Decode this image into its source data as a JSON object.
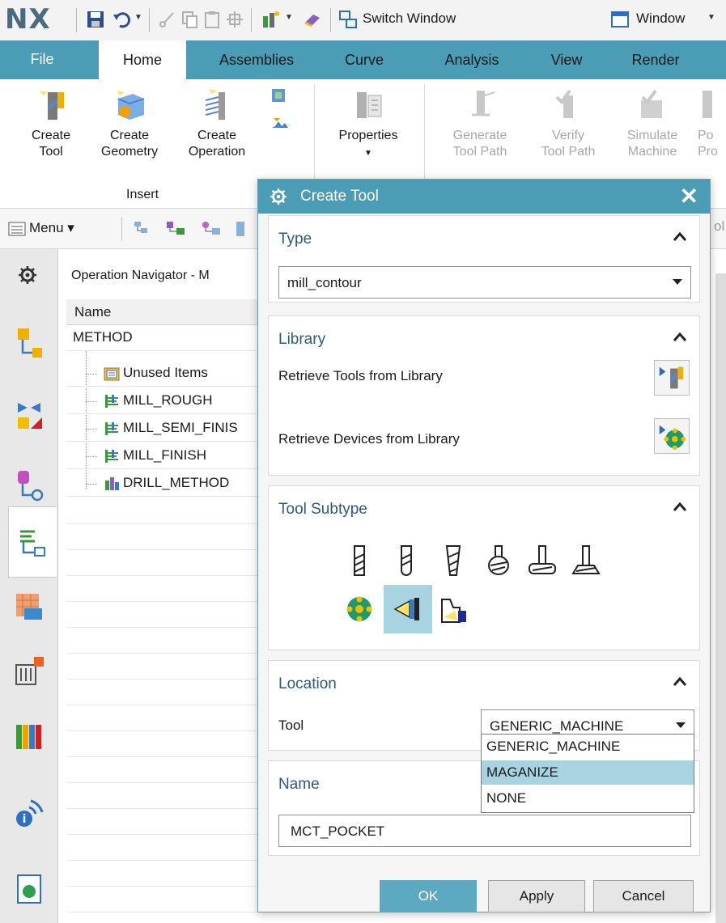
{
  "app": {
    "logo": "NX"
  },
  "quick_access": {
    "switch_window": "Switch Window",
    "window": "Window"
  },
  "ribbon": {
    "tabs": [
      "File",
      "Home",
      "Assemblies",
      "Curve",
      "Analysis",
      "View",
      "Render"
    ],
    "active_tab": "Home",
    "buttons": {
      "create_tool": [
        "Create",
        "Tool"
      ],
      "create_geometry": [
        "Create",
        "Geometry"
      ],
      "create_operation": [
        "Create",
        "Operation"
      ],
      "properties": "Properties",
      "generate_tool_path": [
        "Generate",
        "Tool Path"
      ],
      "verify_tool_path": [
        "Verify",
        "Tool Path"
      ],
      "simulate_machine": [
        "Simulate",
        "Machine"
      ],
      "post_process": [
        "Po",
        "Pro"
      ]
    },
    "group_insert": "Insert"
  },
  "toolbar2": {
    "menu": "Menu"
  },
  "navigator": {
    "title": "Operation Navigator - M",
    "column_name": "Name",
    "root": "METHOD",
    "items": [
      "Unused Items",
      "MILL_ROUGH",
      "MILL_SEMI_FINIS",
      "MILL_FINISH",
      "DRILL_METHOD"
    ]
  },
  "dialog": {
    "title": "Create Tool",
    "close_glyph": "✕",
    "type": {
      "title": "Type",
      "value": "mill_contour"
    },
    "library": {
      "title": "Library",
      "retrieve_tools": "Retrieve Tools from Library",
      "retrieve_devices": "Retrieve Devices from Library"
    },
    "subtype": {
      "title": "Tool Subtype",
      "icons": [
        "mill-tool-icon",
        "ball-mill-icon",
        "taper-mill-icon",
        "barrel-mill-icon",
        "t-cutter-icon",
        "dovetail-icon",
        "tool-magazine-icon",
        "pocket-icon",
        "holder-icon"
      ],
      "selected": "pocket-icon"
    },
    "location": {
      "title": "Location",
      "tool_label": "Tool",
      "tool_value": "GENERIC_MACHINE",
      "options": [
        "GENERIC_MACHINE",
        "MAGANIZE",
        "NONE"
      ],
      "highlighted": "MAGANIZE"
    },
    "name": {
      "title": "Name",
      "value": "MCT_POCKET"
    },
    "buttons": {
      "ok": "OK",
      "apply": "Apply",
      "cancel": "Cancel"
    }
  },
  "colors": {
    "accent": "#4a9db5",
    "selection": "#a8d4e2",
    "section_title": "#2d5a7b"
  }
}
